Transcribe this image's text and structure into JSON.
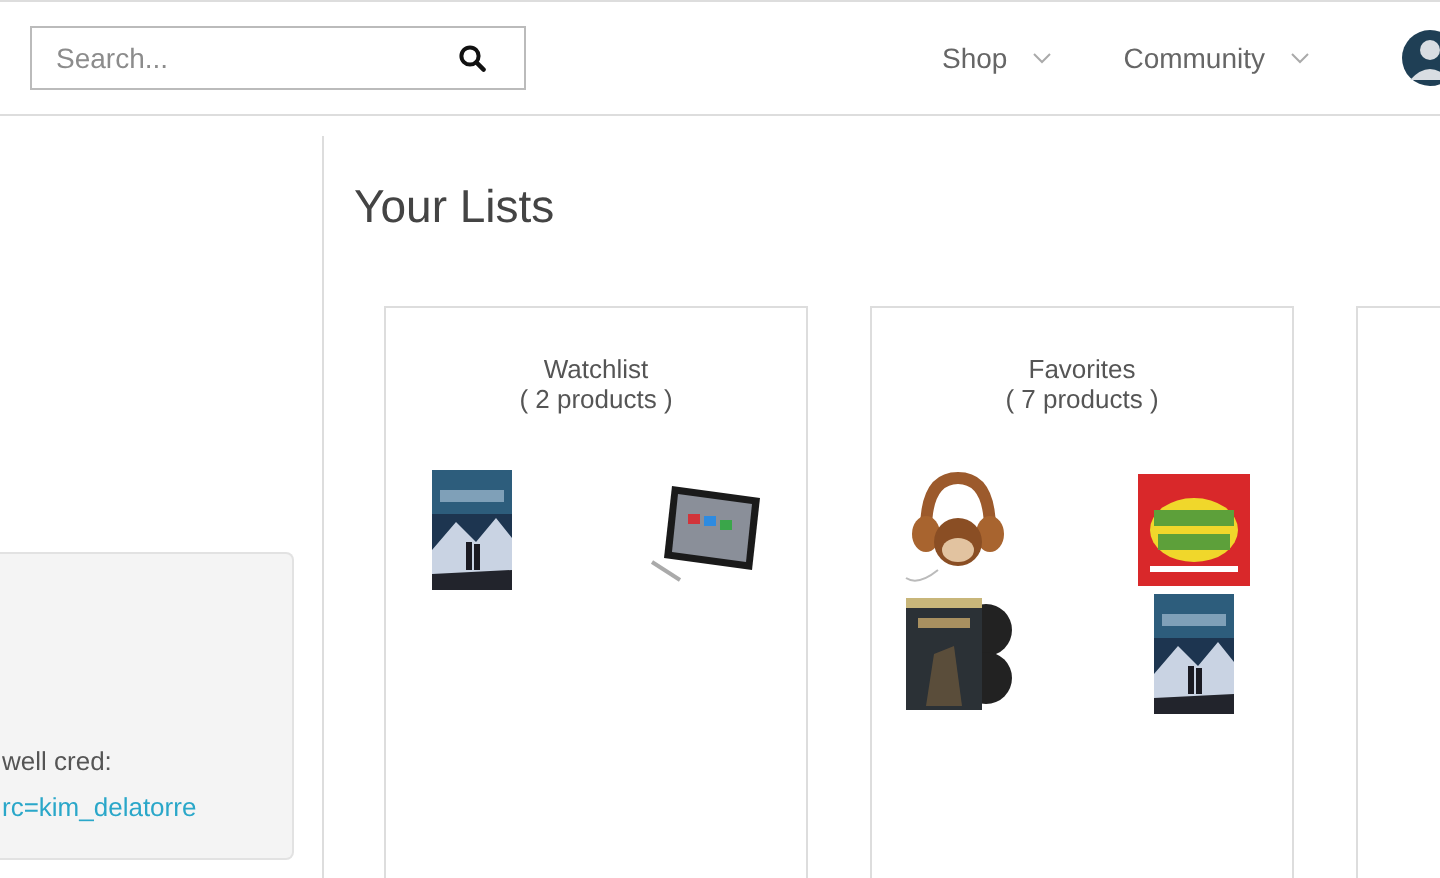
{
  "header": {
    "search": {
      "placeholder": "Search..."
    },
    "menu": [
      {
        "label": "Shop"
      },
      {
        "label": "Community"
      }
    ]
  },
  "sidebar": {
    "note": {
      "text": "well cred:",
      "link": "rc=kim_delatorre"
    }
  },
  "page_title": "Your Lists",
  "lists": [
    {
      "name": "Watchlist",
      "count": "( 2 products )"
    },
    {
      "name": "Favorites",
      "count": "( 7 products )"
    }
  ]
}
